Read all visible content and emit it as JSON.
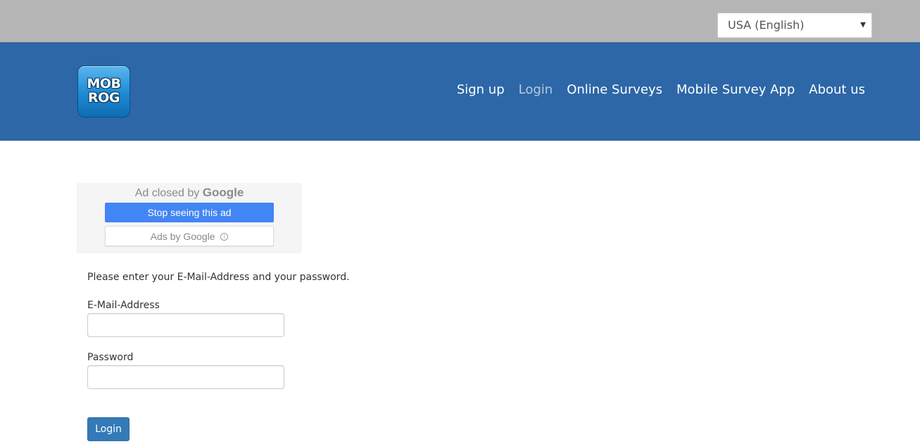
{
  "language_selector": {
    "selected": "USA (English)"
  },
  "logo": {
    "line1": "MOB",
    "line2": "ROG"
  },
  "nav": {
    "items": [
      {
        "label": "Sign up",
        "active": false
      },
      {
        "label": "Login",
        "active": true
      },
      {
        "label": "Online Surveys",
        "active": false
      },
      {
        "label": "Mobile Survey App",
        "active": false
      },
      {
        "label": "About us",
        "active": false
      }
    ]
  },
  "ad": {
    "closed_text": "Ad closed by",
    "closed_brand": "Google",
    "stop_button": "Stop seeing this ad",
    "ads_by_button": "Ads by Google",
    "info_icon": "ⓘ"
  },
  "login_form": {
    "instructions": "Please enter your E-Mail-Address and your password.",
    "email_label": "E-Mail-Address",
    "email_value": "",
    "password_label": "Password",
    "password_value": "",
    "submit_label": "Login"
  },
  "colors": {
    "topbar": "#b5b5b5",
    "header": "#2d67a7",
    "nav_active": "#b8c9dd",
    "ad_stop_button": "#4285f4",
    "login_button": "#337ab7"
  }
}
